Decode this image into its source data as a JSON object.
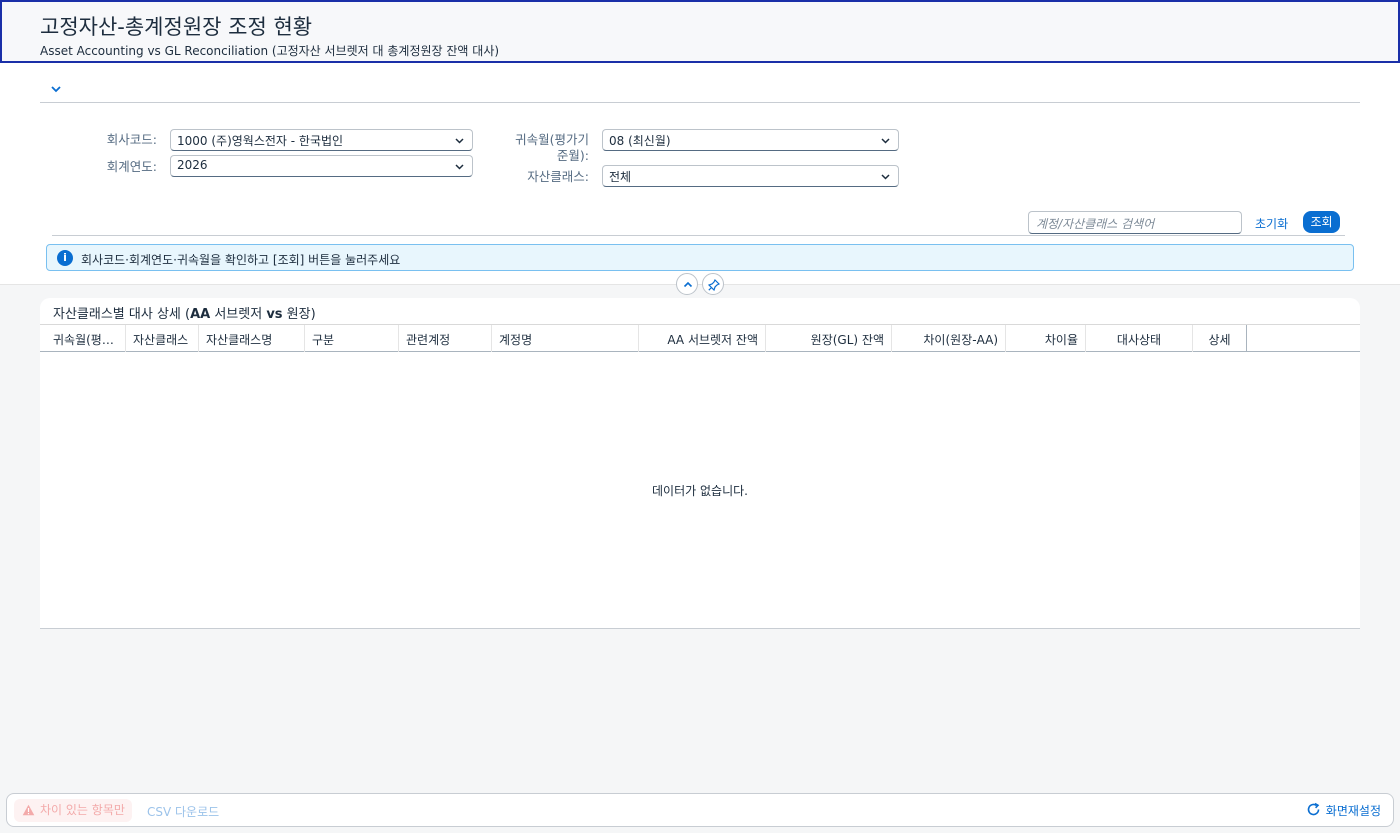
{
  "page": {
    "title": "고정자산-총계정원장 조정 현황",
    "subtitle": "Asset Accounting vs GL Reconciliation (고정자산 서브렛저 대 총계정원장 잔액 대사)"
  },
  "filters": {
    "company_code": {
      "label": "회사코드:",
      "value": "1000 (주)영웍스전자 - 한국법인"
    },
    "fiscal_year": {
      "label": "회계연도:",
      "value": "2026"
    },
    "period": {
      "label_line1": "귀속월(평가기",
      "label_line2": "준월):",
      "value": "08 (최신월)"
    },
    "asset_class": {
      "label": "자산클래스:",
      "value": "전체"
    }
  },
  "toolbar": {
    "search_placeholder": "계정/자산클래스 검색어",
    "reset_label": "초기화",
    "query_label": "조회"
  },
  "info_message": "회사코드·회계연도·귀속월을 확인하고 [조회] 버튼을 눌러주세요",
  "table": {
    "title_part1": "자산클래스별 대사 상세 (",
    "title_bold1": "AA",
    "title_part2": " 서브렛저 ",
    "title_bold2": "vs",
    "title_part3": " 원장)",
    "columns": [
      "귀속월(평가기준월)",
      "자산클래스",
      "자산클래스명",
      "구분",
      "관련계정",
      "계정명",
      "AA 서브렛저 잔액",
      "원장(GL) 잔액",
      "차이(원장-AA)",
      "차이율",
      "대사상태",
      "상세"
    ],
    "no_data_text": "데이터가 없습니다."
  },
  "footer": {
    "diff_only_label": "차이 있는 항목만",
    "csv_label": "CSV 다운로드",
    "reset_view_label": "화면재설정"
  },
  "colors": {
    "accent": "#0a6ed1",
    "title_border": "#1a2fa8",
    "info_bg": "#e8f6fd",
    "warn_text": "#f3aaaa"
  }
}
